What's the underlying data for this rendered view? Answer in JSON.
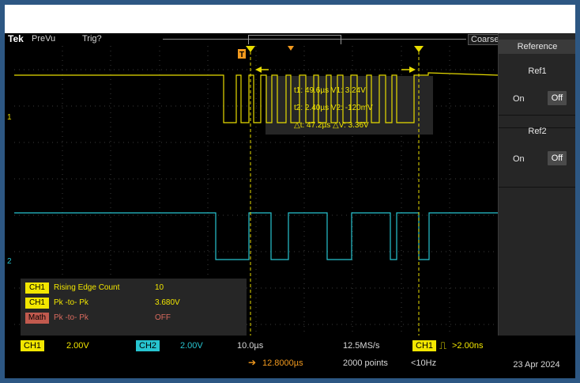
{
  "status_bar": {
    "brand": "Tek",
    "mode": "PreVu",
    "trigger_status": "Trig?",
    "coarse_label": "Coarse"
  },
  "reference_panel": {
    "title": "Reference",
    "ref1": {
      "name": "Ref1",
      "on_label": "On",
      "off_label": "Off"
    },
    "ref2": {
      "name": "Ref2",
      "on_label": "On",
      "off_label": "Off"
    }
  },
  "cursor_readout": {
    "line1": "t1: 49.6µs  V1: 3.24V",
    "line2": "t2: 2.40µs  V2: -120mV",
    "line3": "△t: 47.2µs  △V: 3.36V"
  },
  "channel_markers": {
    "ch1": "1",
    "ch2": "2"
  },
  "measurements": [
    {
      "badge": "CH1",
      "label": "Rising Edge Count",
      "value": "10",
      "badge_color": "#f2e600"
    },
    {
      "badge": "CH1",
      "label": "Pk -to- Pk",
      "value": "3.680V",
      "badge_color": "#f2e600"
    },
    {
      "badge": "Math",
      "label": "Pk -to- Pk",
      "value": "OFF",
      "badge_color": "#c25a4e"
    }
  ],
  "settings": {
    "ch1_badge": "CH1",
    "ch1_scale": "2.00V",
    "ch2_badge": "CH2",
    "ch2_scale": "2.00V",
    "timebase": "10.0µs",
    "sample_rate": "12.5MS/s",
    "trigger_source": "CH1",
    "trigger_condition": ">2.00ns",
    "delay": "12.8000µs",
    "record_length": "2000 points",
    "trigger_frequency": "<10Hz",
    "date": "23 Apr 2024"
  },
  "colors": {
    "ch1": "#f2e600",
    "ch2": "#27c4d0",
    "cursor": "#f2e600",
    "math": "#c25a4e",
    "trigger_marker": "#f29a1e",
    "bezel": "#2d5783"
  },
  "icons": {
    "trigger_marker": "t-flag-icon",
    "trigger_slope": "pulse-width-icon",
    "delay_arrow": "delay-arrow-icon"
  }
}
